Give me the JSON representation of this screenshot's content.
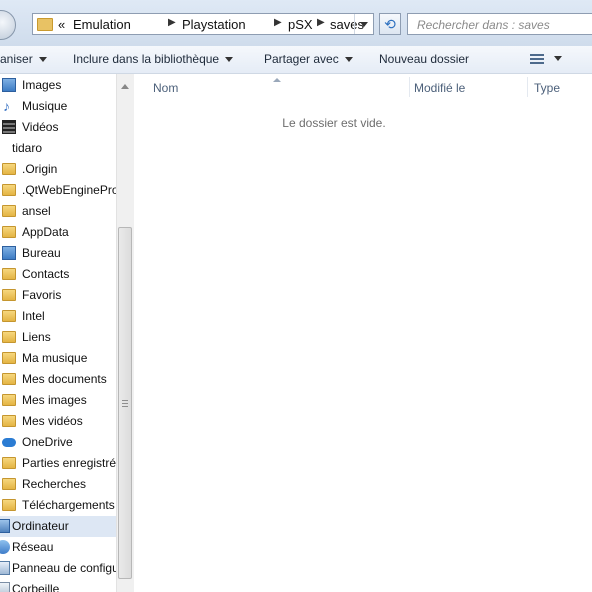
{
  "address": {
    "prefix": "«",
    "crumbs": [
      "Emulation",
      "Playstation",
      "pSX",
      "saves"
    ],
    "search_placeholder": "Rechercher dans : saves"
  },
  "toolbar": {
    "organize": "aniser",
    "include_library": "Inclure dans la bibliothèque",
    "share_with": "Partager avec",
    "new_folder": "Nouveau dossier"
  },
  "nav": {
    "items": [
      {
        "label": "Images",
        "icon": "pictures-library-icon"
      },
      {
        "label": "Musique",
        "icon": "music-library-icon"
      },
      {
        "label": "Vidéos",
        "icon": "videos-library-icon"
      },
      {
        "label": "tidaro",
        "icon": "user-folder-icon"
      },
      {
        "label": ".Origin",
        "icon": "folder-icon"
      },
      {
        "label": ".QtWebEnginePro",
        "icon": "folder-icon"
      },
      {
        "label": "ansel",
        "icon": "folder-icon"
      },
      {
        "label": "AppData",
        "icon": "folder-icon"
      },
      {
        "label": "Bureau",
        "icon": "desktop-folder-icon"
      },
      {
        "label": "Contacts",
        "icon": "contacts-folder-icon"
      },
      {
        "label": "Favoris",
        "icon": "favorites-folder-icon"
      },
      {
        "label": "Intel",
        "icon": "folder-icon"
      },
      {
        "label": "Liens",
        "icon": "links-folder-icon"
      },
      {
        "label": "Ma musique",
        "icon": "music-folder-icon"
      },
      {
        "label": "Mes documents",
        "icon": "documents-folder-icon"
      },
      {
        "label": "Mes images",
        "icon": "pictures-folder-icon"
      },
      {
        "label": "Mes vidéos",
        "icon": "videos-folder-icon"
      },
      {
        "label": "OneDrive",
        "icon": "onedrive-cloud-icon"
      },
      {
        "label": "Parties enregistrée",
        "icon": "saved-games-folder-icon"
      },
      {
        "label": "Recherches",
        "icon": "searches-folder-icon"
      },
      {
        "label": "Téléchargements",
        "icon": "downloads-folder-icon"
      },
      {
        "label": "Ordinateur",
        "icon": "computer-icon"
      },
      {
        "label": "Réseau",
        "icon": "network-icon"
      },
      {
        "label": "Panneau de configu",
        "icon": "control-panel-icon"
      },
      {
        "label": "Corbeille",
        "icon": "recycle-bin-icon"
      }
    ],
    "selected_label": "Ordinateur"
  },
  "columns": {
    "name": "Nom",
    "modified": "Modifié le",
    "type": "Type"
  },
  "empty_message": "Le dossier est vide.",
  "colors": {
    "accent": "#2b7cd3",
    "selection": "#dde7f4",
    "folder": "#e8c264"
  }
}
